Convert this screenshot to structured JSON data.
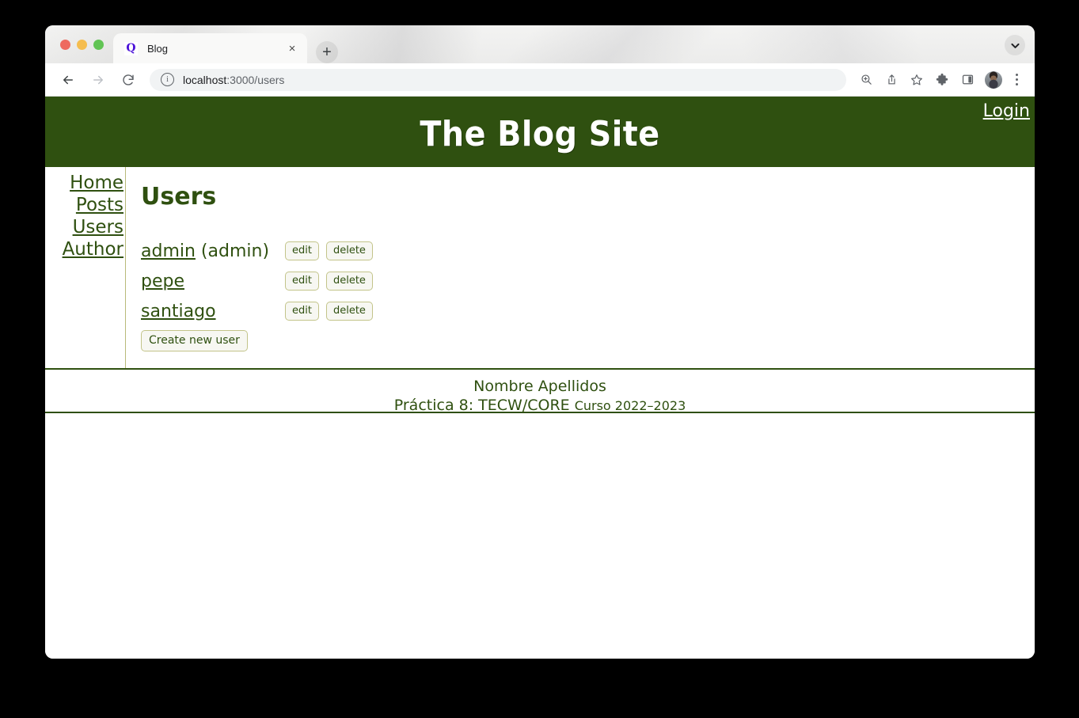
{
  "browser": {
    "tab": {
      "title": "Blog",
      "favicon": "Q",
      "close_label": "×"
    },
    "new_tab_label": "+",
    "tabstrip_expand_icon": "chevron-down-icon",
    "toolbar": {
      "back_icon": "back-arrow-icon",
      "forward_icon": "forward-arrow-icon",
      "reload_icon": "reload-icon",
      "url_main": "localhost",
      "url_rest": ":3000/users",
      "info_icon": "info-circle-icon",
      "zoom_icon": "zoom-search-icon",
      "share_icon": "share-icon",
      "bookmark_icon": "star-bookmark-icon",
      "extensions_icon": "puzzle-extensions-icon",
      "sidepanel_icon": "side-panel-icon",
      "avatar_icon": "profile-avatar",
      "menu_icon": "three-dot-menu-icon"
    }
  },
  "site": {
    "title": "The Blog Site",
    "login_label": "Login",
    "nav": [
      {
        "label": "Home"
      },
      {
        "label": "Posts"
      },
      {
        "label": "Users"
      },
      {
        "label": "Author"
      }
    ],
    "page_title": "Users",
    "users": [
      {
        "name": "admin",
        "role": " (admin)",
        "edit_label": "edit",
        "delete_label": "delete"
      },
      {
        "name": "pepe",
        "role": "",
        "edit_label": "edit",
        "delete_label": "delete"
      },
      {
        "name": "santiago",
        "role": "",
        "edit_label": "edit",
        "delete_label": "delete"
      }
    ],
    "create_button": "Create new user",
    "footer": {
      "line1": "Nombre Apellidos",
      "line2_main": "Práctica 8: TECW/CORE",
      "line2_small": "Curso 2022–2023"
    }
  },
  "colors": {
    "brand_green": "#2f5010",
    "button_border": "#c3c48a",
    "button_bg": "#f7f7f2",
    "divider": "#b9ba7a"
  }
}
